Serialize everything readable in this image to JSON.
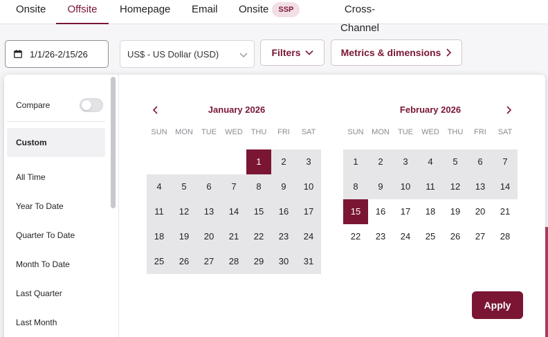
{
  "tabs": [
    {
      "label": "Onsite"
    },
    {
      "label": "Offsite"
    },
    {
      "label": "Homepage"
    },
    {
      "label": "Email"
    },
    {
      "label": "Onsite",
      "badge": "SSP"
    },
    {
      "label": "Cross-Channel"
    }
  ],
  "toolbar": {
    "date_range": "1/1/26-2/15/26",
    "currency": "US$ - US Dollar (USD)",
    "filters_label": "Filters",
    "metrics_label": "Metrics & dimensions"
  },
  "presets": {
    "compare_label": "Compare",
    "compare_on": false,
    "items": [
      "Custom",
      "All Time",
      "Year To Date",
      "Quarter To Date",
      "Month To Date",
      "Last Quarter",
      "Last Month"
    ],
    "selected": "Custom"
  },
  "weekdays": [
    "SUN",
    "MON",
    "TUE",
    "WED",
    "THU",
    "FRI",
    "SAT"
  ],
  "calendars": [
    {
      "title": "January 2026",
      "first_weekday": 4,
      "days": 31,
      "range_start": 1,
      "range_end": 31,
      "selected": [
        1
      ]
    },
    {
      "title": "February 2026",
      "first_weekday": 0,
      "days": 28,
      "range_start": 1,
      "range_end": 15,
      "selected": [
        15
      ]
    }
  ],
  "apply_label": "Apply",
  "colors": {
    "accent": "#7a1634",
    "range": "#e6e6e8"
  }
}
